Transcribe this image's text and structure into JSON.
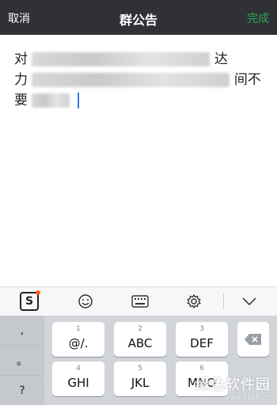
{
  "nav": {
    "cancel_label": "取消",
    "title": "群公告",
    "done_label": "完成"
  },
  "editor": {
    "line1_start": "对",
    "line1_end": "达",
    "line2_start": "力",
    "line2_end": "间不",
    "line3_start": "要"
  },
  "toolbar": {
    "items": [
      "sogou-logo-icon",
      "emoji-icon",
      "keyboard-icon",
      "settings-icon",
      "collapse-icon"
    ]
  },
  "keyboard": {
    "punct": [
      ",",
      "。",
      "?"
    ],
    "row1": [
      {
        "num": "1",
        "label": "@/."
      },
      {
        "num": "2",
        "label": "ABC"
      },
      {
        "num": "3",
        "label": "DEF"
      }
    ],
    "row2": [
      {
        "num": "4",
        "label": "GHI"
      },
      {
        "num": "5",
        "label": "JKL"
      },
      {
        "num": "6",
        "label": "MNO"
      }
    ],
    "delete_icon": "backspace-icon"
  },
  "watermark": {
    "title": "绿色软件园",
    "url": "www.ksoft.cc"
  }
}
